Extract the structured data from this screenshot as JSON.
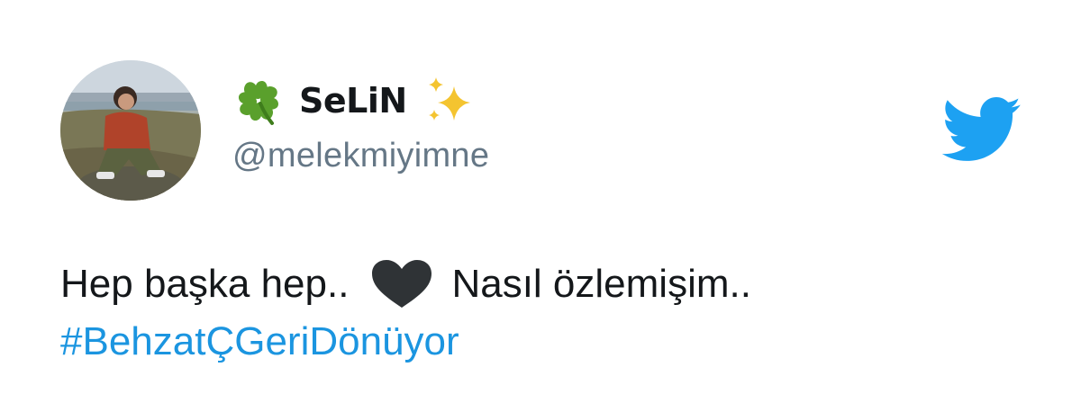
{
  "tweet": {
    "display_name": "SeLiN",
    "handle": "@melekmiyimne",
    "text_part1": "Hep başka hep..",
    "text_part2": "Nasıl özlemişim..",
    "hashtag": "#BehzatÇGeriDönüyor",
    "icons": {
      "name_prefix": "four-leaf-clover-icon",
      "name_suffix": "sparkles-icon",
      "inline_emoji": "black-heart-icon",
      "brand": "twitter-bird-icon"
    }
  },
  "colors": {
    "brand_blue": "#1da1f2",
    "hashtag_blue": "#1b95e0",
    "handle_gray": "#657786",
    "text_dark": "#14171a",
    "clover_green": "#5aa02c",
    "sparkle_gold": "#f4c430",
    "heart_dark": "#2f3336"
  }
}
